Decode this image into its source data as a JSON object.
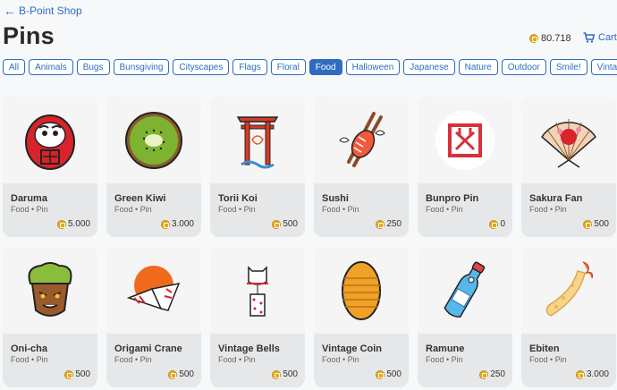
{
  "nav": {
    "back_label": "B-Point Shop"
  },
  "page": {
    "title": "Pins"
  },
  "header": {
    "balance": "80.718",
    "cart_label": "Cart"
  },
  "categories": [
    "All",
    "Animals",
    "Bugs",
    "Bunsgiving",
    "Cityscapes",
    "Flags",
    "Floral",
    "Food",
    "Halloween",
    "Japanese",
    "Nature",
    "Outdoor",
    "Smile!",
    "Vintage"
  ],
  "active_category": "Food",
  "items": [
    {
      "name": "Daruma",
      "meta": "Food • Pin",
      "price": "5.000",
      "icon": "daruma-icon"
    },
    {
      "name": "Green Kiwi",
      "meta": "Food • Pin",
      "price": "3.000",
      "icon": "kiwi-icon"
    },
    {
      "name": "Torii Koi",
      "meta": "Food • Pin",
      "price": "500",
      "icon": "torii-koi-icon"
    },
    {
      "name": "Sushi",
      "meta": "Food • Pin",
      "price": "250",
      "icon": "sushi-icon"
    },
    {
      "name": "Bunpro Pin",
      "meta": "Food • Pin",
      "price": "0",
      "icon": "bunpro-logo-icon"
    },
    {
      "name": "Sakura Fan",
      "meta": "Food • Pin",
      "price": "500",
      "icon": "sakura-fan-icon"
    },
    {
      "name": "Oni-cha",
      "meta": "Food • Pin",
      "price": "500",
      "icon": "oni-cha-icon"
    },
    {
      "name": "Origami Crane",
      "meta": "Food • Pin",
      "price": "500",
      "icon": "origami-crane-icon"
    },
    {
      "name": "Vintage Bells",
      "meta": "Food • Pin",
      "price": "500",
      "icon": "wind-bell-icon"
    },
    {
      "name": "Vintage Coin",
      "meta": "Food • Pin",
      "price": "500",
      "icon": "koban-coin-icon"
    },
    {
      "name": "Ramune",
      "meta": "Food • Pin",
      "price": "250",
      "icon": "ramune-bottle-icon"
    },
    {
      "name": "Ebiten",
      "meta": "Food • Pin",
      "price": "3.000",
      "icon": "ebiten-icon"
    }
  ],
  "colors": {
    "accent": "#2f6cc0",
    "coin": "#e3a92b",
    "card_bg": "#e6e7e8"
  }
}
